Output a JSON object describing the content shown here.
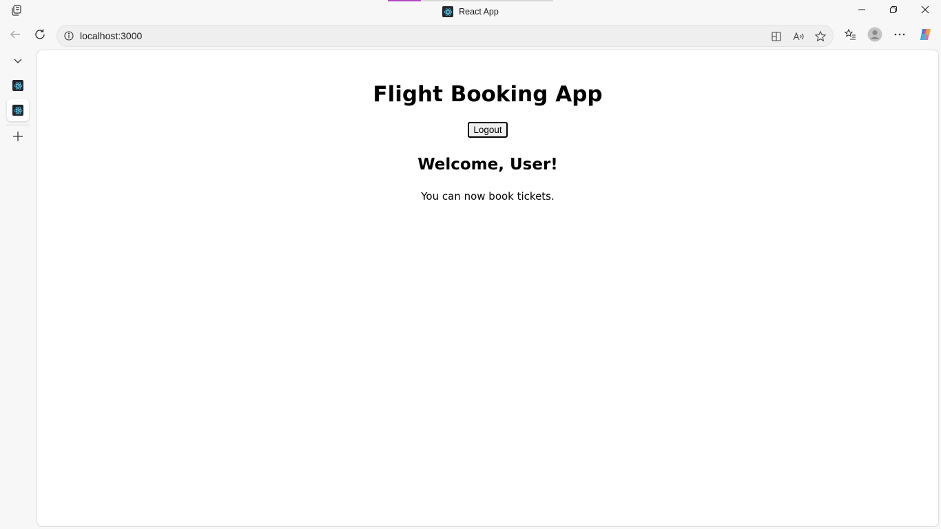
{
  "browser": {
    "window_title": "React App",
    "tab_loading_progress": 0.2,
    "address": {
      "url": "localhost:3000"
    },
    "icons": {
      "workspaces": "workspaces-icon",
      "back": "back-arrow-icon",
      "refresh": "refresh-icon",
      "site_info": "info-icon",
      "app_available": "app-available-icon",
      "read_aloud": "read-aloud-icon",
      "favorite": "star-icon",
      "favorites_list": "favorites-icon",
      "profile": "profile-avatar-icon",
      "more": "more-icon",
      "copilot": "copilot-icon"
    },
    "sidebar": {
      "items": [
        {
          "name": "collapse-tabs",
          "icon": "chevron-down-icon"
        },
        {
          "name": "tab-react-app-1",
          "icon": "react-icon"
        },
        {
          "name": "tab-react-app-2",
          "icon": "react-icon",
          "active": true
        },
        {
          "name": "new-tab",
          "icon": "plus-icon"
        }
      ]
    },
    "colors": {
      "chrome_bg": "#f7f7f7",
      "tab_loading": "#b146c2",
      "react_favicon_bg": "#23272f",
      "react_favicon_fg": "#61dafb"
    }
  },
  "page": {
    "title": "Flight Booking App",
    "logout_label": "Logout",
    "welcome_heading": "Welcome, User!",
    "message": "You can now book tickets."
  }
}
